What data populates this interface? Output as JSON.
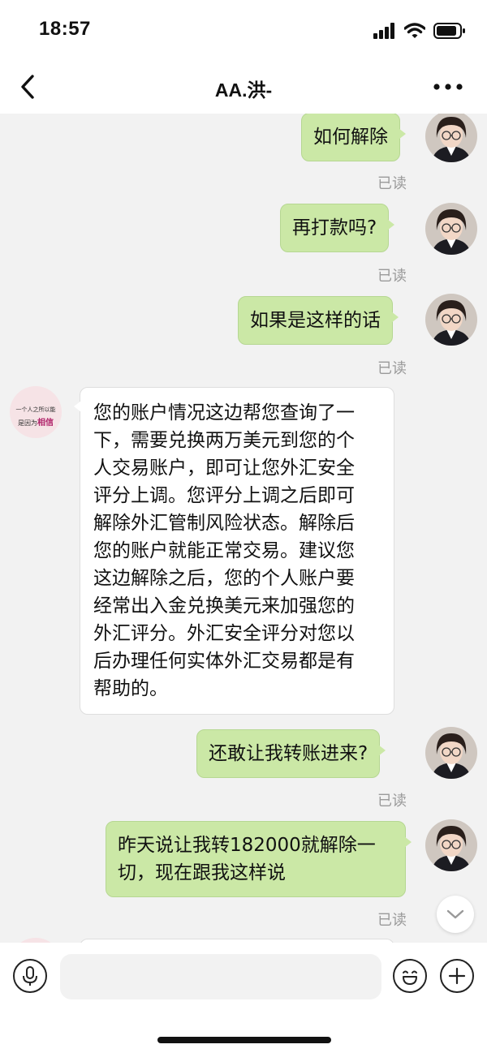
{
  "status_bar": {
    "time": "18:57"
  },
  "header": {
    "title": "AA.洪-"
  },
  "messages": [
    {
      "sender": "me",
      "text": "如何解除",
      "status": "已读"
    },
    {
      "sender": "me",
      "text": "再打款吗?",
      "status": "已读"
    },
    {
      "sender": "me",
      "text": "如果是这样的话",
      "status": "已读"
    },
    {
      "sender": "other",
      "lines": [
        "您的账户情况这边帮您查询了一",
        "下，需要兑换两万美元到您的个",
        "人交易账户，即可让您外汇安全",
        "评分上调。您评分上调之后即可",
        "解除外汇管制风险状态。解除后",
        "您的账户就能正常交易。建议您",
        "这边解除之后，您的个人账户要",
        "经常出入金兑换美元来加强您的",
        "外汇评分。外汇安全评分对您以",
        "后办理任何实体外汇交易都是有",
        "帮助的。"
      ]
    },
    {
      "sender": "me",
      "text": "还敢让我转账进来?",
      "status": "已读"
    },
    {
      "sender": "me",
      "lines": [
        "昨天说让我转182000就解除一",
        "切，现在跟我这样说"
      ],
      "status": "已读"
    }
  ],
  "other_avatar": {
    "line1": "一个人之所以能",
    "line2": "是因为",
    "highlight": "相信"
  },
  "input": {
    "placeholder": ""
  },
  "colors": {
    "my_bubble": "#cbe8a6",
    "other_bubble": "#ffffff",
    "read": "#9a9a9a"
  },
  "icons": [
    "back-icon",
    "more-icon",
    "microphone-icon",
    "emoji-icon",
    "plus-icon",
    "chevron-down-icon",
    "signal-icon",
    "wifi-icon",
    "battery-icon"
  ]
}
